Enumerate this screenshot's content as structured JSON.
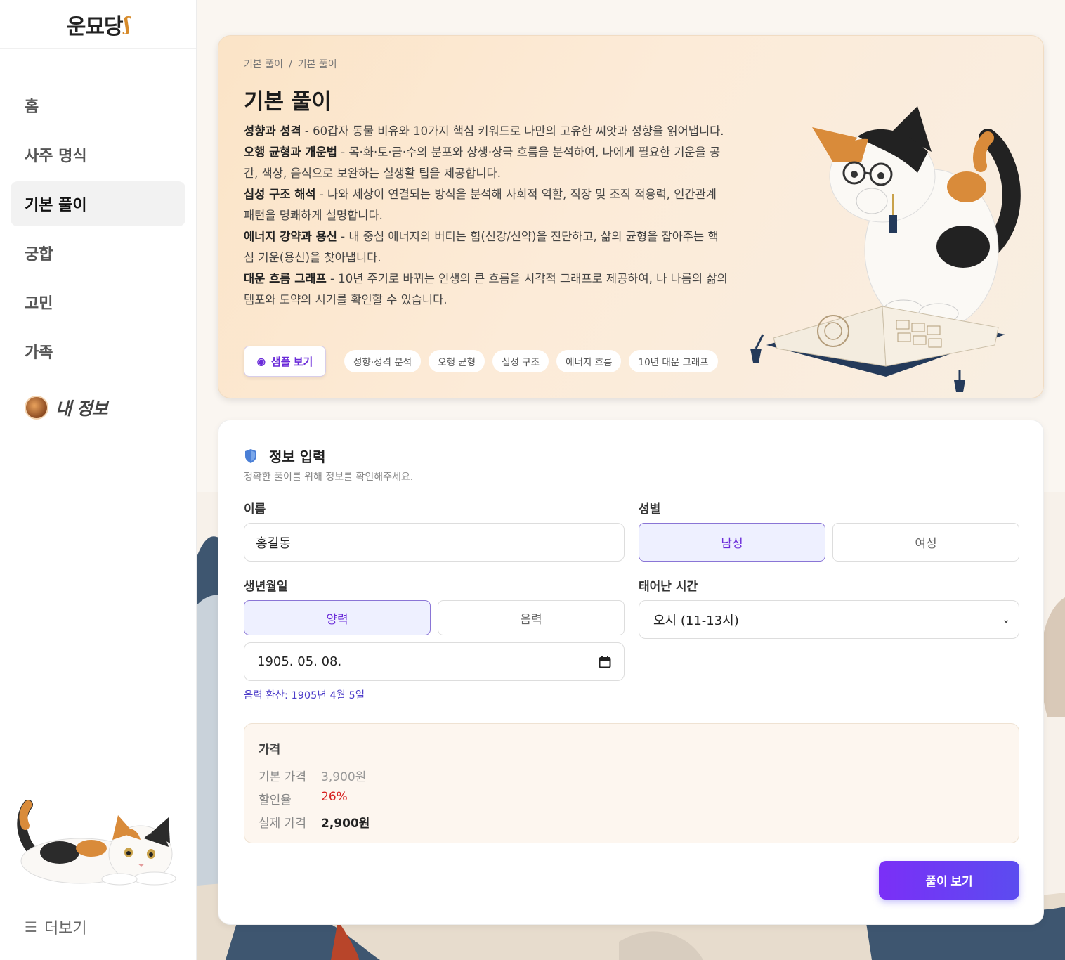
{
  "sidebar": {
    "logo": "운묘당",
    "items": [
      {
        "label": "홈",
        "active": false
      },
      {
        "label": "사주 명식",
        "active": false
      },
      {
        "label": "기본 풀이",
        "active": true
      },
      {
        "label": "궁합",
        "active": false
      },
      {
        "label": "고민",
        "active": false
      },
      {
        "label": "가족",
        "active": false
      }
    ],
    "my_info": "내 정보",
    "more": "더보기"
  },
  "hero": {
    "breadcrumb": [
      "기본 풀이",
      "기본 풀이"
    ],
    "title": "기본 풀이",
    "features": [
      {
        "title": "성향과 성격",
        "text": " - 60갑자 동물 비유와 10가지 핵심 키워드로 나만의 고유한 씨앗과 성향을 읽어냅니다."
      },
      {
        "title": "오행 균형과 개운법",
        "text": " - 목·화·토·금·수의 분포와 상생·상극 흐름을 분석하여, 나에게 필요한 기운을 공간, 색상, 음식으로 보완하는 실생활 팁을 제공합니다."
      },
      {
        "title": "십성 구조 해석",
        "text": " - 나와 세상이 연결되는 방식을 분석해 사회적 역할, 직장 및 조직 적응력, 인간관계 패턴을 명쾌하게 설명합니다."
      },
      {
        "title": "에너지 강약과 용신",
        "text": " - 내 중심 에너지의 버티는 힘(신강/신약)을 진단하고, 삶의 균형을 잡아주는 핵심 기운(용신)을 찾아냅니다."
      },
      {
        "title": "대운 흐름 그래프",
        "text": " - 10년 주기로 바뀌는 인생의 큰 흐름을 시각적 그래프로 제공하여, 나 나름의 삶의 템포와 도약의 시기를 확인할 수 있습니다."
      }
    ],
    "sample_button": "샘플 보기",
    "tags": [
      "성향·성격 분석",
      "오행 균형",
      "십성 구조",
      "에너지 흐름",
      "10년 대운 그래프"
    ]
  },
  "form": {
    "title": "정보 입력",
    "subtitle": "정확한 풀이를 위해 정보를 확인해주세요.",
    "name_label": "이름",
    "name_value": "홍길동",
    "gender_label": "성별",
    "gender_options": [
      "남성",
      "여성"
    ],
    "gender_selected": "남성",
    "birth_label": "생년월일",
    "calendar_options": [
      "양력",
      "음력"
    ],
    "calendar_selected": "양력",
    "birth_value": "1905. 05. 08.",
    "time_label": "태어난 시간",
    "time_value": "오시 (11-13시)",
    "lunar_note": "음력 환산: 1905년 4월 5일",
    "submit": "풀이 보기"
  },
  "price": {
    "title": "가격",
    "base_label": "기본 가격",
    "base_value": "3,900원",
    "discount_label": "할인율",
    "discount_value": "26%",
    "final_label": "실제 가격",
    "final_value": "2,900원"
  },
  "colors": {
    "accent": "#6a2bd9",
    "button_gradient_start": "#7b2ff7",
    "button_gradient_end": "#5b4cf0",
    "discount": "#d61f1f"
  }
}
